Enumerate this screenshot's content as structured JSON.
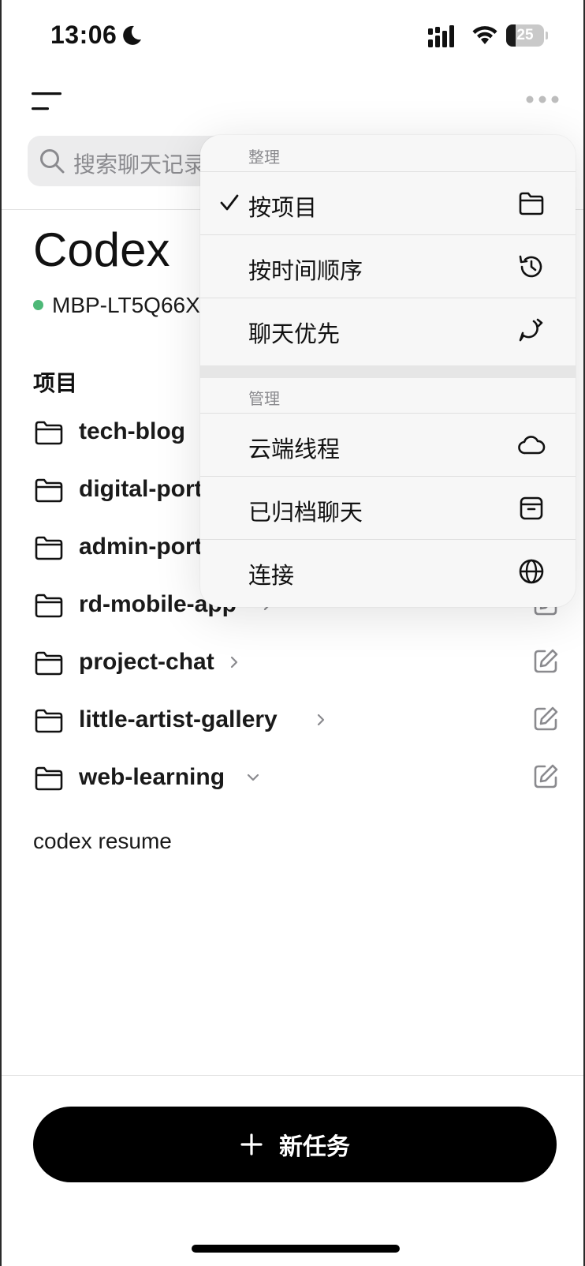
{
  "status_bar": {
    "time": "13:06",
    "battery_level": "25",
    "battery_fraction": 0.25
  },
  "search": {
    "placeholder": "搜索聊天记录"
  },
  "page": {
    "title": "Codex",
    "device_name": "MBP-LT5Q66X",
    "device_status_color": "#4db877"
  },
  "projects": {
    "section_title": "项目",
    "items": [
      {
        "name": "tech-blog",
        "chevron": "right"
      },
      {
        "name": "digital-portal",
        "chevron": "right"
      },
      {
        "name": "admin-portal",
        "chevron": "right"
      },
      {
        "name": "rd-mobile-app",
        "chevron": "right"
      },
      {
        "name": "project-chat",
        "chevron": "right"
      },
      {
        "name": "little-artist-gallery",
        "chevron": "right"
      },
      {
        "name": "web-learning",
        "chevron": "down"
      }
    ]
  },
  "resume_text": "codex resume",
  "new_task": {
    "label": "新任务"
  },
  "dropdown": {
    "group1_title": "整理",
    "group1_items": [
      {
        "label": "按项目",
        "icon": "folder-icon",
        "checked": true
      },
      {
        "label": "按时间顺序",
        "icon": "history-icon",
        "checked": false
      },
      {
        "label": "聊天优先",
        "icon": "chat-refresh-icon",
        "checked": false
      }
    ],
    "group2_title": "管理",
    "group2_items": [
      {
        "label": "云端线程",
        "icon": "cloud-icon"
      },
      {
        "label": "已归档聊天",
        "icon": "archive-icon"
      },
      {
        "label": "连接",
        "icon": "globe-icon"
      }
    ]
  }
}
